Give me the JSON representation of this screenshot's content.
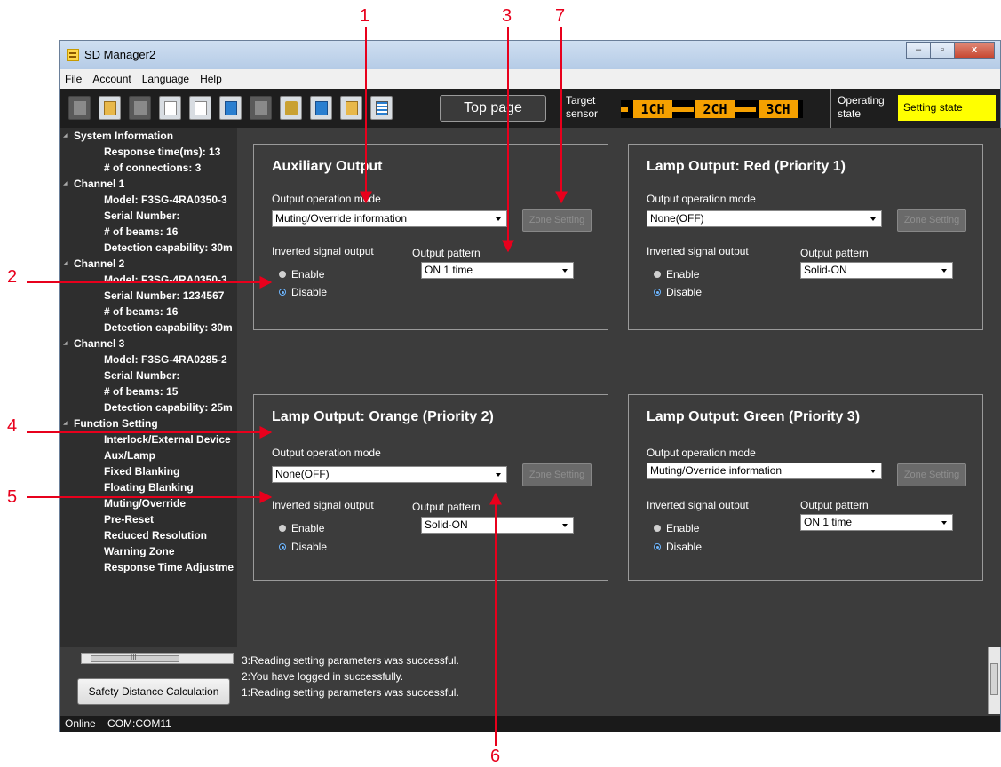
{
  "callouts": [
    "1",
    "2",
    "3",
    "4",
    "5",
    "6",
    "7"
  ],
  "window": {
    "title": "SD Manager2",
    "controls": [
      "–",
      "▫",
      "x"
    ]
  },
  "menu": [
    "File",
    "Account",
    "Language",
    "Help"
  ],
  "toolbar": {
    "top_page_label": "Top page",
    "target_label_1": "Target",
    "target_label_2": "sensor",
    "channels": [
      "1CH",
      "2CH",
      "3CH"
    ],
    "operating_label_1": "Operating",
    "operating_label_2": "state",
    "operating_state": "Setting state",
    "accent_color": "#f5a000",
    "state_color": "#ffff00"
  },
  "sidebar": {
    "items": [
      {
        "text": "System Information",
        "level": 0
      },
      {
        "text": "Response time(ms): 13",
        "level": 1
      },
      {
        "text": "# of connections: 3",
        "level": 1
      },
      {
        "text": "Channel 1",
        "level": 0
      },
      {
        "text": "Model: F3SG-4RA0350-3",
        "level": 1
      },
      {
        "text": "Serial Number:",
        "level": 1
      },
      {
        "text": "# of beams: 16",
        "level": 1
      },
      {
        "text": "Detection capability: 30m",
        "level": 1
      },
      {
        "text": "Channel 2",
        "level": 0
      },
      {
        "text": "Model: F3SG-4RA0350-3",
        "level": 1
      },
      {
        "text": "Serial Number: 1234567",
        "level": 1
      },
      {
        "text": "# of beams: 16",
        "level": 1
      },
      {
        "text": "Detection capability: 30m",
        "level": 1
      },
      {
        "text": "Channel 3",
        "level": 0
      },
      {
        "text": "Model: F3SG-4RA0285-2",
        "level": 1
      },
      {
        "text": "Serial Number:",
        "level": 1
      },
      {
        "text": "# of beams: 15",
        "level": 1
      },
      {
        "text": "Detection capability: 25m",
        "level": 1
      },
      {
        "text": "Function Setting",
        "level": 0
      },
      {
        "text": "Interlock/External Device",
        "level": 1
      },
      {
        "text": "Aux/Lamp",
        "level": 1
      },
      {
        "text": "Fixed Blanking",
        "level": 1
      },
      {
        "text": "Floating Blanking",
        "level": 1
      },
      {
        "text": "Muting/Override",
        "level": 1
      },
      {
        "text": "Pre-Reset",
        "level": 1
      },
      {
        "text": "Reduced Resolution",
        "level": 1
      },
      {
        "text": "Warning Zone",
        "level": 1
      },
      {
        "text": "Response Time Adjustme",
        "level": 1
      }
    ],
    "scroll_label": "III",
    "sdc_button": "Safety Distance Calculation"
  },
  "panels": [
    {
      "title": "Auxiliary Output",
      "mode_label": "Output operation mode",
      "mode_value": "Muting/Override information",
      "zone_button": "Zone Setting",
      "inverted_label": "Inverted signal output",
      "enable": "Enable",
      "disable": "Disable",
      "selected": "Disable",
      "pattern_label": "Output pattern",
      "pattern_value": "ON 1 time"
    },
    {
      "title": "Lamp Output: Red (Priority 1)",
      "mode_label": "Output operation mode",
      "mode_value": "None(OFF)",
      "zone_button": "Zone Setting",
      "inverted_label": "Inverted signal output",
      "enable": "Enable",
      "disable": "Disable",
      "selected": "Disable",
      "pattern_label": "Output pattern",
      "pattern_value": "Solid-ON"
    },
    {
      "title": "Lamp Output: Orange (Priority 2)",
      "mode_label": "Output operation mode",
      "mode_value": "None(OFF)",
      "zone_button": "Zone Setting",
      "inverted_label": "Inverted signal output",
      "enable": "Enable",
      "disable": "Disable",
      "selected": "Disable",
      "pattern_label": "Output pattern",
      "pattern_value": "Solid-ON"
    },
    {
      "title": "Lamp Output: Green (Priority 3)",
      "mode_label": "Output operation mode",
      "mode_value": "Muting/Override information",
      "zone_button": "Zone Setting",
      "inverted_label": "Inverted signal output",
      "enable": "Enable",
      "disable": "Disable",
      "selected": "Disable",
      "pattern_label": "Output pattern",
      "pattern_value": "ON 1 time"
    }
  ],
  "log": [
    "3:Reading setting parameters was successful.",
    "2:You have logged in successfully.",
    "1:Reading setting parameters was successful."
  ],
  "status": {
    "text": "Online    COM:COM11"
  }
}
